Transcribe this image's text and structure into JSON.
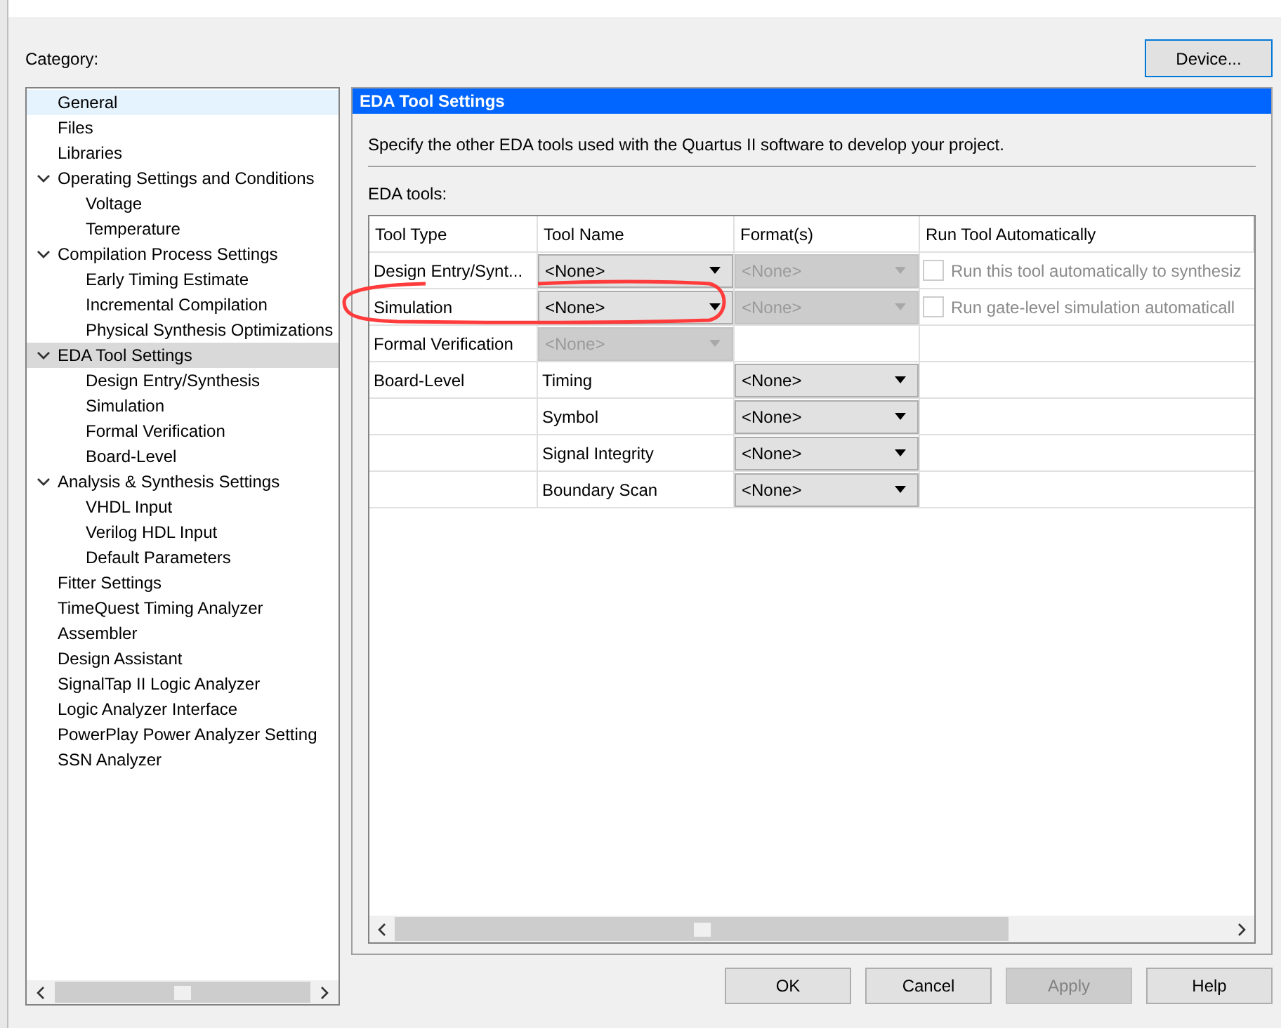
{
  "category_label": "Category:",
  "device_button": "Device...",
  "tree": [
    {
      "label": "General",
      "selected": false,
      "hovered": true
    },
    {
      "label": "Files",
      "selected": false,
      "hovered": false
    },
    {
      "label": "Libraries",
      "selected": false,
      "hovered": false
    },
    {
      "label": "Operating Settings and Conditions",
      "selected": false,
      "hovered": false,
      "expanded": true,
      "children": [
        {
          "label": "Voltage",
          "selected": false,
          "hovered": false
        },
        {
          "label": "Temperature",
          "selected": false,
          "hovered": false
        }
      ]
    },
    {
      "label": "Compilation Process Settings",
      "selected": false,
      "hovered": false,
      "expanded": true,
      "children": [
        {
          "label": "Early Timing Estimate",
          "selected": false,
          "hovered": false
        },
        {
          "label": "Incremental Compilation",
          "selected": false,
          "hovered": false
        },
        {
          "label": "Physical Synthesis Optimizations",
          "selected": false,
          "hovered": false
        }
      ]
    },
    {
      "label": "EDA Tool Settings",
      "selected": true,
      "hovered": false,
      "expanded": true,
      "children": [
        {
          "label": "Design Entry/Synthesis",
          "selected": false,
          "hovered": false
        },
        {
          "label": "Simulation",
          "selected": false,
          "hovered": false
        },
        {
          "label": "Formal Verification",
          "selected": false,
          "hovered": false
        },
        {
          "label": "Board-Level",
          "selected": false,
          "hovered": false
        }
      ]
    },
    {
      "label": "Analysis & Synthesis Settings",
      "selected": false,
      "hovered": false,
      "expanded": true,
      "children": [
        {
          "label": "VHDL Input",
          "selected": false,
          "hovered": false
        },
        {
          "label": "Verilog HDL Input",
          "selected": false,
          "hovered": false
        },
        {
          "label": "Default Parameters",
          "selected": false,
          "hovered": false
        }
      ]
    },
    {
      "label": "Fitter Settings",
      "selected": false,
      "hovered": false
    },
    {
      "label": "TimeQuest Timing Analyzer",
      "selected": false,
      "hovered": false
    },
    {
      "label": "Assembler",
      "selected": false,
      "hovered": false
    },
    {
      "label": "Design Assistant",
      "selected": false,
      "hovered": false
    },
    {
      "label": "SignalTap II Logic Analyzer",
      "selected": false,
      "hovered": false
    },
    {
      "label": "Logic Analyzer Interface",
      "selected": false,
      "hovered": false
    },
    {
      "label": "PowerPlay Power Analyzer Setting",
      "selected": false,
      "hovered": false
    },
    {
      "label": "SSN Analyzer",
      "selected": false,
      "hovered": false
    }
  ],
  "panel": {
    "title": "EDA Tool Settings",
    "description": "Specify the other EDA tools used with the Quartus II software to develop your project.",
    "section_label": "EDA tools:"
  },
  "table": {
    "columns": [
      "Tool Type",
      "Tool Name",
      "Format(s)",
      "Run Tool Automatically"
    ],
    "rows": [
      {
        "tool_type": "Design Entry/Synt...",
        "tool_name": {
          "kind": "dropdown",
          "value": "<None>",
          "disabled": false
        },
        "format": {
          "value": "<None>",
          "disabled": true
        },
        "run_auto": {
          "label": "Run this tool automatically to synthesiz",
          "checked": false,
          "disabled": true
        }
      },
      {
        "tool_type": "Simulation",
        "tool_name": {
          "kind": "dropdown",
          "value": "<None>",
          "disabled": false
        },
        "format": {
          "value": "<None>",
          "disabled": true
        },
        "run_auto": {
          "label": "Run gate-level simulation automaticall",
          "checked": false,
          "disabled": true
        }
      },
      {
        "tool_type": "Formal Verification",
        "tool_name": {
          "kind": "dropdown",
          "value": "<None>",
          "disabled": true
        }
      },
      {
        "tool_type": "Board-Level",
        "tool_name": {
          "kind": "text",
          "value": "Timing"
        },
        "format": {
          "value": "<None>",
          "disabled": false
        }
      },
      {
        "tool_name": {
          "kind": "text",
          "value": "Symbol"
        },
        "format": {
          "value": "<None>",
          "disabled": false
        }
      },
      {
        "tool_name": {
          "kind": "text",
          "value": "Signal Integrity"
        },
        "format": {
          "value": "<None>",
          "disabled": false
        }
      },
      {
        "tool_name": {
          "kind": "text",
          "value": "Boundary Scan"
        },
        "format": {
          "value": "<None>",
          "disabled": false
        }
      }
    ]
  },
  "buttons": [
    {
      "label": "OK",
      "disabled": false
    },
    {
      "label": "Cancel",
      "disabled": false
    },
    {
      "label": "Apply",
      "disabled": true
    },
    {
      "label": "Help",
      "disabled": false
    }
  ]
}
